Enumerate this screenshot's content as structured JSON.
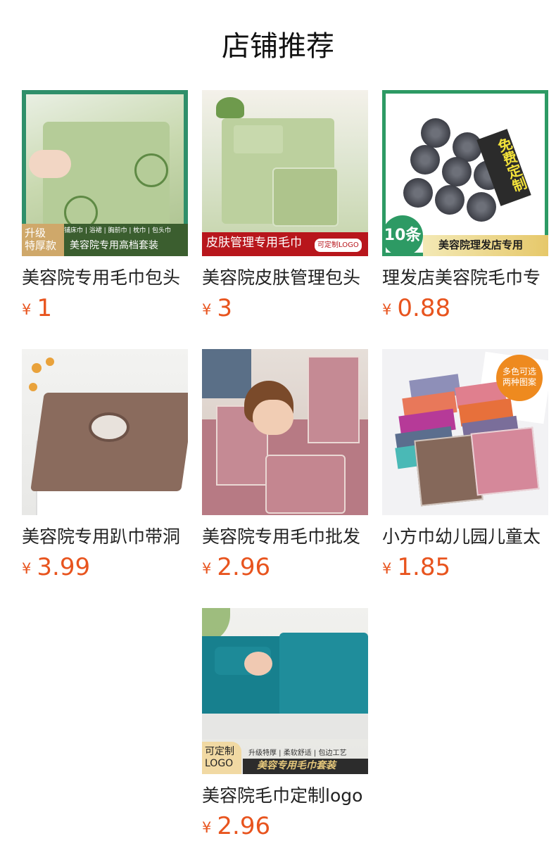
{
  "page": {
    "title": "店铺推荐"
  },
  "colors": {
    "price": "#e8541e",
    "title": "#111111",
    "name": "#222222"
  },
  "products": [
    {
      "name": "美容院专用毛巾包头",
      "currency": "¥",
      "price": "1",
      "image": {
        "icon": "green-towel-set-photo",
        "badge": "升级\n特厚款",
        "strip": "铺床巾 | 浴裙 | 胸前巾 | 枕巾 | 包头巾",
        "banner": "美容院专用高档套装"
      }
    },
    {
      "name": "美容院皮肤管理包头",
      "currency": "¥",
      "price": "3",
      "image": {
        "icon": "green-towel-bag-photo",
        "banner": "皮肤管理专用毛巾",
        "badge": "可定制LOGO"
      }
    },
    {
      "name": "理发店美容院毛巾专",
      "currency": "¥",
      "price": "0.88",
      "image": {
        "icon": "rolled-grey-towels-photo",
        "badge": "10条",
        "side": "免费定制",
        "banner": "美容院理发店专用"
      }
    },
    {
      "name": "美容院专用趴巾带洞",
      "currency": "¥",
      "price": "3.99",
      "image": {
        "icon": "brown-face-hole-towel-photo"
      }
    },
    {
      "name": "美容院专用毛巾批发",
      "currency": "¥",
      "price": "2.96",
      "image": {
        "icon": "pink-towel-model-photo"
      }
    },
    {
      "name": "小方巾幼儿园儿童太",
      "currency": "¥",
      "price": "1.85",
      "image": {
        "icon": "colorful-square-towels-photo",
        "badge": "多色可选\n两种图案"
      }
    },
    {
      "name": "美容院毛巾定制logo",
      "currency": "¥",
      "price": "2.96",
      "image": {
        "icon": "teal-towel-set-photo",
        "badge": "可定制\nLOGO",
        "strip": "升级特厚 | 柔软舒适 | 包边工艺",
        "banner": "美容专用毛巾套装"
      }
    }
  ]
}
